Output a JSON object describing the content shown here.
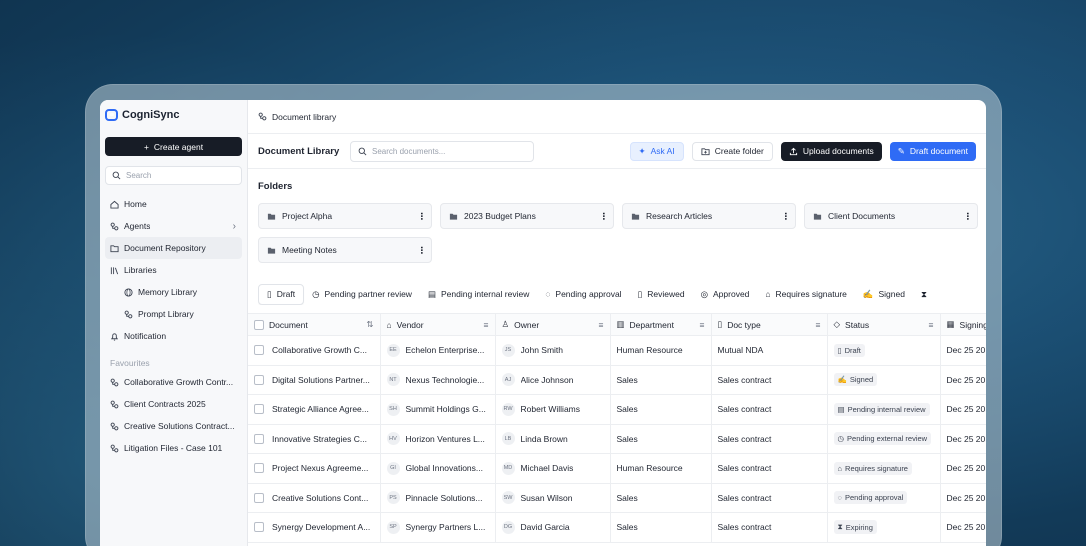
{
  "app": {
    "name": "CogniSync"
  },
  "sidebar": {
    "create_label": "Create agent",
    "search_placeholder": "Search",
    "items": [
      {
        "label": "Home",
        "icon": "home-icon"
      },
      {
        "label": "Agents",
        "icon": "agents-icon"
      },
      {
        "label": "Document Repository",
        "icon": "folder-icon"
      },
      {
        "label": "Libraries",
        "icon": "library-icon"
      },
      {
        "label": "Memory Library",
        "icon": "globe-icon"
      },
      {
        "label": "Prompt Library",
        "icon": "prompt-icon"
      },
      {
        "label": "Notification",
        "icon": "bell-icon"
      }
    ],
    "favourites_title": "Favourites",
    "favourites": [
      "Collaborative Growth Contr...",
      "Client Contracts 2025",
      "Creative Solutions Contract...",
      "Litigation Files - Case 101"
    ]
  },
  "breadcrumb": "Document library",
  "toolbar": {
    "title": "Document Library",
    "search_placeholder": "Search documents...",
    "ask_ai": "Ask AI",
    "create_folder": "Create folder",
    "upload": "Upload documents",
    "draft": "Draft document"
  },
  "folders": {
    "title": "Folders",
    "items": [
      "Project Alpha",
      "2023 Budget Plans",
      "Research Articles",
      "Client Documents",
      "Meeting Notes"
    ]
  },
  "tabs": [
    "Draft",
    "Pending partner review",
    "Pending internal review",
    "Pending approval",
    "Reviewed",
    "Approved",
    "Requires signature",
    "Signed",
    "Expiring"
  ],
  "table": {
    "columns": [
      "Document",
      "Vendor",
      "Owner",
      "Department",
      "Doc type",
      "Status",
      "Signing"
    ],
    "rows": [
      {
        "document": "Collaborative Growth C...",
        "vendor_initials": "EE",
        "vendor": "Echelon Enterprise...",
        "owner_initials": "JS",
        "owner": "John Smith",
        "department": "Human Resource",
        "doc_type": "Mutual NDA",
        "status": "Draft",
        "signing": "Dec 25 20"
      },
      {
        "document": "Digital Solutions Partner...",
        "vendor_initials": "NT",
        "vendor": "Nexus Technologie...",
        "owner_initials": "AJ",
        "owner": "Alice Johnson",
        "department": "Sales",
        "doc_type": "Sales contract",
        "status": "Signed",
        "signing": "Dec 25 20"
      },
      {
        "document": "Strategic Alliance Agree...",
        "vendor_initials": "SH",
        "vendor": "Summit Holdings G...",
        "owner_initials": "RW",
        "owner": "Robert Williams",
        "department": "Sales",
        "doc_type": "Sales contract",
        "status": "Pending internal review",
        "signing": "Dec 25 20"
      },
      {
        "document": "Innovative Strategies C...",
        "vendor_initials": "HV",
        "vendor": "Horizon Ventures L...",
        "owner_initials": "LB",
        "owner": "Linda Brown",
        "department": "Sales",
        "doc_type": "Sales contract",
        "status": "Pending external review",
        "signing": "Dec 25 20"
      },
      {
        "document": "Project Nexus Agreeme...",
        "vendor_initials": "GI",
        "vendor": "Global Innovations...",
        "owner_initials": "MD",
        "owner": "Michael Davis",
        "department": "Human Resource",
        "doc_type": "Sales contract",
        "status": "Requires signature",
        "signing": "Dec 25 20"
      },
      {
        "document": "Creative Solutions Cont...",
        "vendor_initials": "PS",
        "vendor": "Pinnacle Solutions...",
        "owner_initials": "SW",
        "owner": "Susan Wilson",
        "department": "Sales",
        "doc_type": "Sales contract",
        "status": "Pending approval",
        "signing": "Dec 25 20"
      },
      {
        "document": "Synergy Development A...",
        "vendor_initials": "SP",
        "vendor": "Synergy Partners L...",
        "owner_initials": "DG",
        "owner": "David Garcia",
        "department": "Sales",
        "doc_type": "Sales contract",
        "status": "Expiring",
        "signing": "Dec 25 20"
      }
    ]
  },
  "colors": {
    "accent": "#2f6bf5",
    "dark": "#171c26"
  }
}
